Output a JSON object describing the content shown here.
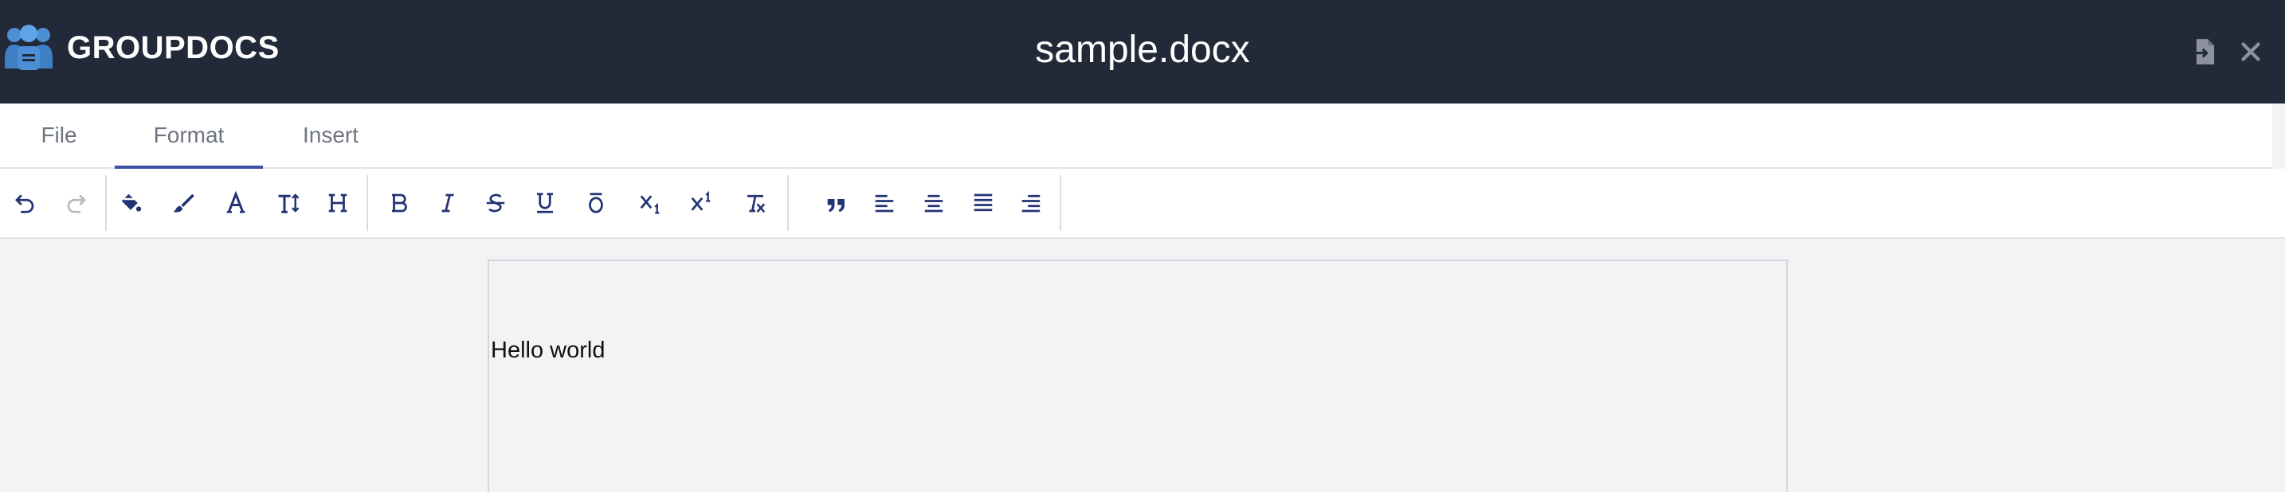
{
  "header": {
    "brand": "GROUPDOCS",
    "document_title": "sample.docx"
  },
  "tabs": [
    {
      "label": "File",
      "active": false
    },
    {
      "label": "Format",
      "active": true
    },
    {
      "label": "Insert",
      "active": false
    }
  ],
  "toolbar": {
    "icons": [
      "undo-icon",
      "redo-icon",
      "paint-bucket-icon",
      "brush-icon",
      "font-icon",
      "text-height-icon",
      "heading-icon",
      "bold-icon",
      "italic-icon",
      "strikethrough-icon",
      "underline-icon",
      "subscript-icon",
      "superscript-icon",
      "clear-formatting-icon",
      "blockquote-icon",
      "align-left-icon",
      "align-center-icon",
      "align-justify-icon",
      "align-right-icon"
    ]
  },
  "document": {
    "text": "Hello world"
  },
  "colors": {
    "header_bg": "#222938",
    "tab_active_underline": "#3e4fa6",
    "icon": "#233373",
    "canvas_bg": "#f2f3f5"
  }
}
